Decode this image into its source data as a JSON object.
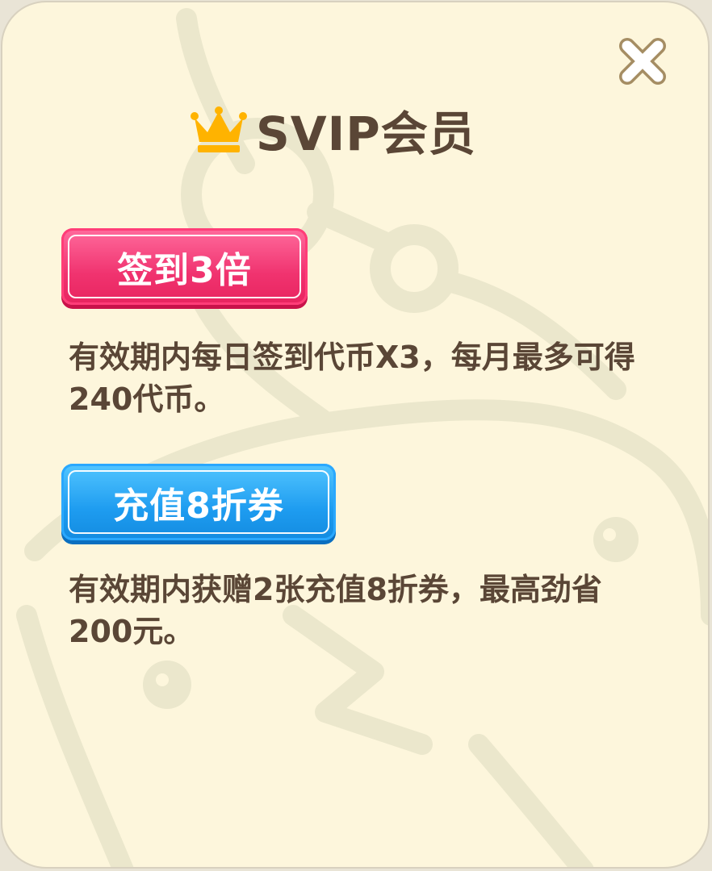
{
  "dialog": {
    "title": "SVIP会员",
    "icons": {
      "crown": "crown-icon",
      "close": "close-icon"
    }
  },
  "benefits": [
    {
      "tag": "签到3倍",
      "tag_color": "#f0336f",
      "description": "有效期内每日签到代币X3，每月最多可得240代币。"
    },
    {
      "tag": "充值8折券",
      "tag_color": "#1e9cf0",
      "description": "有效期内获赠2张充值8折券，最高劲省200元。"
    }
  ],
  "colors": {
    "background": "#fdf6dc",
    "text": "#5a4636",
    "crown": "#ffb300"
  }
}
